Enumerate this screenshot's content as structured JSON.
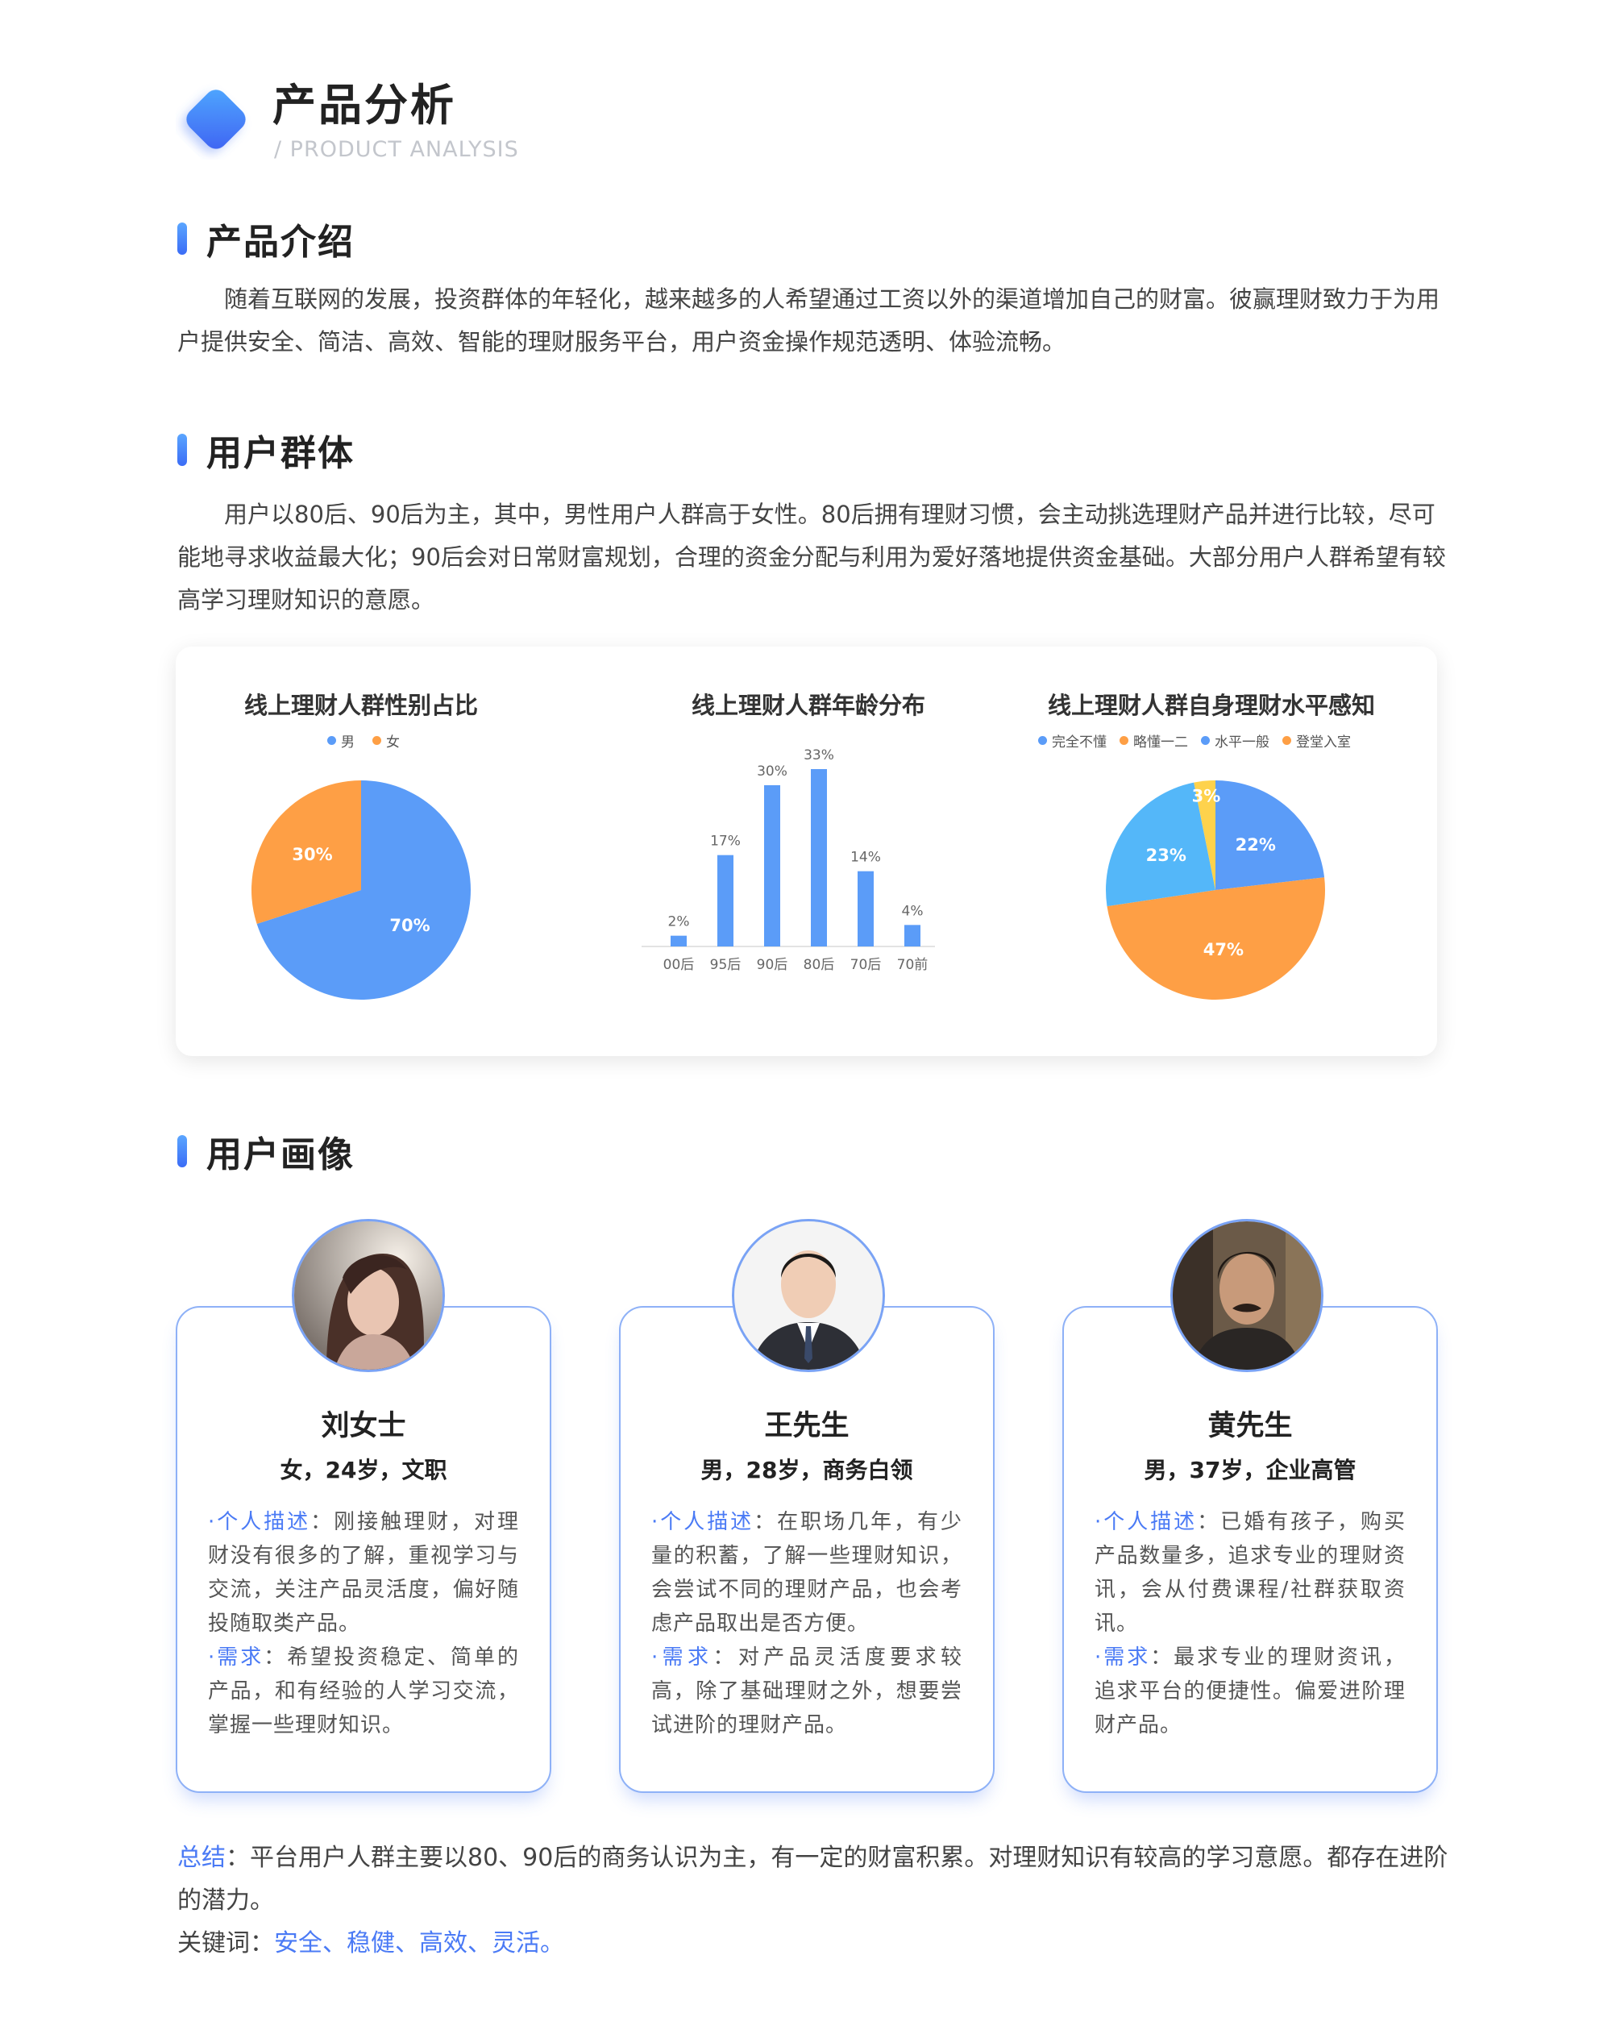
{
  "header": {
    "title": "产品分析",
    "subtitle": "/ PRODUCT ANALYSIS"
  },
  "intro": {
    "title": "产品介绍",
    "text": "随着互联网的发展，投资群体的年轻化，越来越多的人希望通过工资以外的渠道增加自己的财富。彼赢理财致力于为用户提供安全、简洁、高效、智能的理财服务平台，用户资金操作规范透明、体验流畅。"
  },
  "users": {
    "title": "用户群体",
    "text": "用户以80后、90后为主，其中，男性用户人群高于女性。80后拥有理财习惯，会主动挑选理财产品并进行比较，尽可能地寻求收益最大化；90后会对日常财富规划，合理的资金分配与利用为爱好落地提供资金基础。大部分用户人群希望有较高学习理财知识的意愿。"
  },
  "colors": {
    "blue": "#5b9cf8",
    "orange": "#fe9f45",
    "lightblue": "#54b7f9",
    "yellow": "#fed24c",
    "accent": "#4a7af5"
  },
  "chart_data": [
    {
      "type": "pie",
      "title": "线上理财人群性别占比",
      "labels": [
        "男",
        "女"
      ],
      "values": [
        70,
        30
      ],
      "value_labels": [
        "70%",
        "30%"
      ],
      "colors": [
        "#5b9cf8",
        "#fe9f45"
      ],
      "legend": "top"
    },
    {
      "type": "bar",
      "title": "线上理财人群年龄分布",
      "categories": [
        "00后",
        "95后",
        "90后",
        "80后",
        "70后",
        "70前"
      ],
      "values": [
        2,
        17,
        30,
        33,
        14,
        4
      ],
      "value_labels": [
        "2%",
        "17%",
        "30%",
        "33%",
        "14%",
        "4%"
      ],
      "ylim": [
        0,
        33
      ],
      "grid": false
    },
    {
      "type": "pie",
      "title": "线上理财人群自身理财水平感知",
      "labels": [
        "完全不懂",
        "略懂一二",
        "水平一般",
        "登堂入室"
      ],
      "slices": [
        {
          "label": "完全不懂",
          "value": 22,
          "text": "22%",
          "color": "#5b9cf8"
        },
        {
          "label": "略懂一二",
          "value": 47,
          "text": "47%",
          "color": "#fe9f45"
        },
        {
          "label": "水平一般",
          "value": 23,
          "text": "23%",
          "color": "#54b7f9"
        },
        {
          "label": "登堂入室",
          "value": 3,
          "text": "3%",
          "color": "#fed24c"
        }
      ],
      "legend": "top"
    }
  ],
  "persona_section": {
    "title": "用户画像"
  },
  "personas": [
    {
      "name": "刘女士",
      "meta": "女，24岁，文职",
      "desc_label": "·个人描述",
      "desc": "：刚接触理财，对理财没有很多的了解，重视学习与交流，关注产品灵活度，偏好随投随取类产品。",
      "need_label": "·需求",
      "need": "：希望投资稳定、简单的产品，和有经验的人学习交流，掌握一些理财知识。"
    },
    {
      "name": "王先生",
      "meta": "男，28岁，商务白领",
      "desc_label": "·个人描述",
      "desc": "：在职场几年，有少量的积蓄，了解一些理财知识，会尝试不同的理财产品，也会考虑产品取出是否方便。",
      "need_label": "·需求",
      "need": "：对产品灵活度要求较高，除了基础理财之外，想要尝试进阶的理财产品。"
    },
    {
      "name": "黄先生",
      "meta": "男，37岁，企业高管",
      "desc_label": "·个人描述",
      "desc": "：已婚有孩子，购买产品数量多，追求专业的理财资讯，会从付费课程/社群获取资讯。",
      "need_label": "·需求",
      "need": "：最求专业的理财资讯，追求平台的便捷性。偏爱进阶理财产品。"
    }
  ],
  "summary": {
    "label": "总结",
    "text": "：平台用户人群主要以80、90后的商务认识为主，有一定的财富积累。对理财知识有较高的学习意愿。都存在进阶的潜力。",
    "keywords_label": "关键词：",
    "keywords": "安全、稳健、高效、灵活。"
  }
}
